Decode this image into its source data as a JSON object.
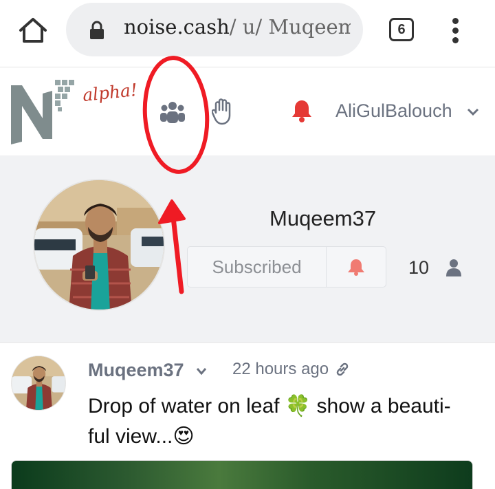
{
  "browser": {
    "url_host": "noise.cash",
    "url_path": "/ u/ Muqeem",
    "tab_count": "6"
  },
  "header": {
    "alpha_label": "alpha!",
    "username": "AliGulBalouch"
  },
  "profile": {
    "name": "Muqeem37",
    "subscribe_label": "Subscribed",
    "subscriber_count": "10"
  },
  "post": {
    "author": "Muqeem37",
    "time": "22 hours ago",
    "text_line1": "Drop of water on leaf 🍀 show a beauti-",
    "text_line2": "ful view...😍"
  },
  "colors": {
    "accent_red": "#e53935",
    "annotation_red": "#ef1b24",
    "muted_gray": "#6b7280",
    "profile_bg": "#f1f2f4"
  },
  "icons": {
    "home": "home-icon",
    "lock": "lock-icon",
    "menu": "more-vert-icon",
    "groups": "users-icon",
    "hand": "raised-hand-icon",
    "bell": "bell-icon",
    "chevron": "chevron-down-icon",
    "person": "person-icon",
    "link": "link-icon"
  }
}
